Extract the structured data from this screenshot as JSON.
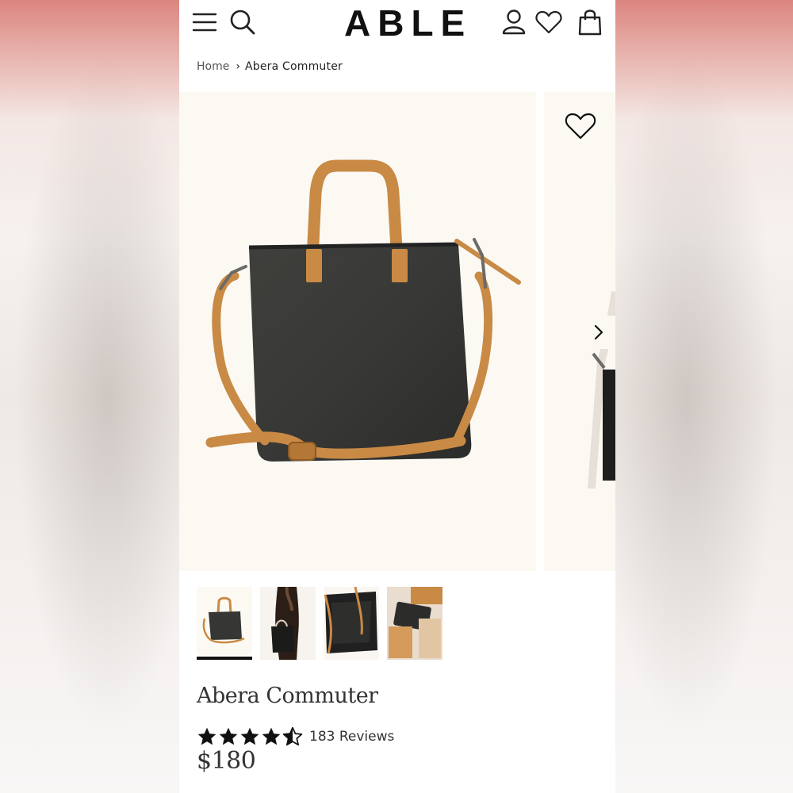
{
  "header": {
    "logo": "ABLE",
    "icons": [
      "menu-icon",
      "search-icon",
      "account-icon",
      "wishlist-icon",
      "shopping-bag-icon"
    ]
  },
  "breadcrumb": {
    "home": "Home",
    "separator": "›",
    "current": "Abera Commuter"
  },
  "gallery": {
    "thumbnails": [
      {
        "name": "bag-front",
        "active": true
      },
      {
        "name": "model-wearing",
        "active": false
      },
      {
        "name": "bag-interior",
        "active": false
      },
      {
        "name": "leather-tag-monogram",
        "active": false
      }
    ],
    "icons": [
      "heart-icon",
      "chevron-right-icon"
    ]
  },
  "product": {
    "title": "Abera Commuter",
    "rating": 4.5,
    "max_rating": 5,
    "reviews": "183 Reviews",
    "price": "$180"
  },
  "colors": {
    "bag_body": "#3a3a38",
    "leather": "#c98a45",
    "image_background": "#fcf9f3",
    "text": "#333333"
  }
}
